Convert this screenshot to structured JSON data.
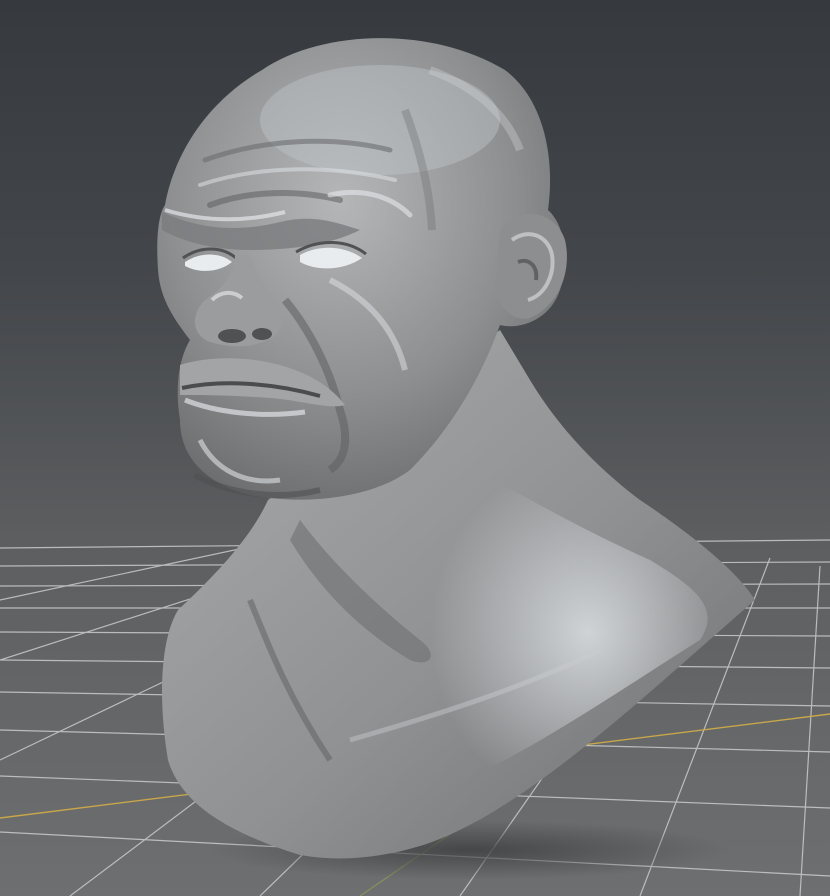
{
  "viewport": {
    "background_top": "#363a3e",
    "background_bottom": "#6e6f70",
    "grid_color": "#c9ccd0",
    "axis_x_color": "#c8a64a",
    "axis_z_color": "#8a9a5b",
    "model_color": "#9a9c9e",
    "model_highlight": "#e4e7ea",
    "model_shadow": "#4a4c4e"
  },
  "model": {
    "type": "sculpt-mesh",
    "subject": "bust"
  }
}
